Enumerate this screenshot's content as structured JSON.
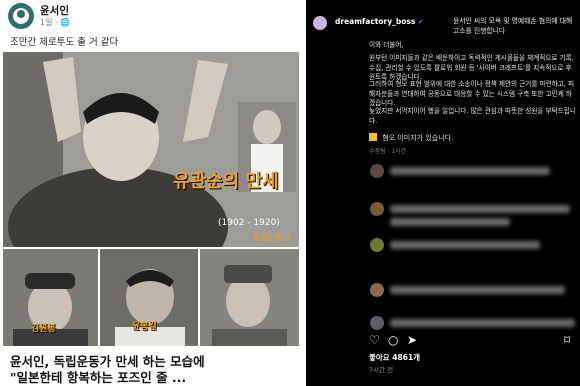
{
  "post": {
    "author": "윤서인",
    "meta": "1일 · 🌐",
    "caption": "조만간 제로투도 출 거 같다",
    "photo_caption_main": "유관순의 만세",
    "photo_years": "(1902 - 1920)",
    "photo_sub_caption": "독립운동가",
    "photo_caption_2": "김원봉",
    "photo_caption_3": "윤봉길",
    "title_line1": "윤서인, 독립운동가 만세 하는 모습에",
    "title_line2": "\"일본한테 항복하는 포즈인 줄 ..."
  },
  "instagram": {
    "username": "dreamfactory_boss",
    "verified": "✔",
    "header_text": "윤서인 씨의 모욕 및 명예훼손 혐의에 대해 고소를 진행합니다",
    "paragraphs": [
      "이와 더불어,",
      "원부턴 이미지들과 같은 배운하이고 독력적인 게시물들을 체계적으로 기록, 수집, 관리할 수 있도록 팔로워 회원 등 '사이버 크래프트'를 지속적으로 후원토록 하겠습니다.",
      "그러하여 형모 표현 범위에 대한 소송이나 정책 제안의 근거를 마련하고, 피해자분들과 연대하여 공동으로 대응할 수 있는 시스템 구축 또한 고민케 하겠습니다.",
      "늦었지만 서먹지이어 했을 일입니다. 많은 관심과 따뜻한 성원을 부탁드립니다."
    ],
    "warning": "혐오 이미지가 있습니다.",
    "edited": "수정됨 · 1시간",
    "likes": "좋아요 4861개",
    "time": "7시간 전"
  },
  "colors": {
    "ig_bg": "#000000",
    "verified_blue": "#3897f0",
    "photo_caption": "#f0a020"
  }
}
